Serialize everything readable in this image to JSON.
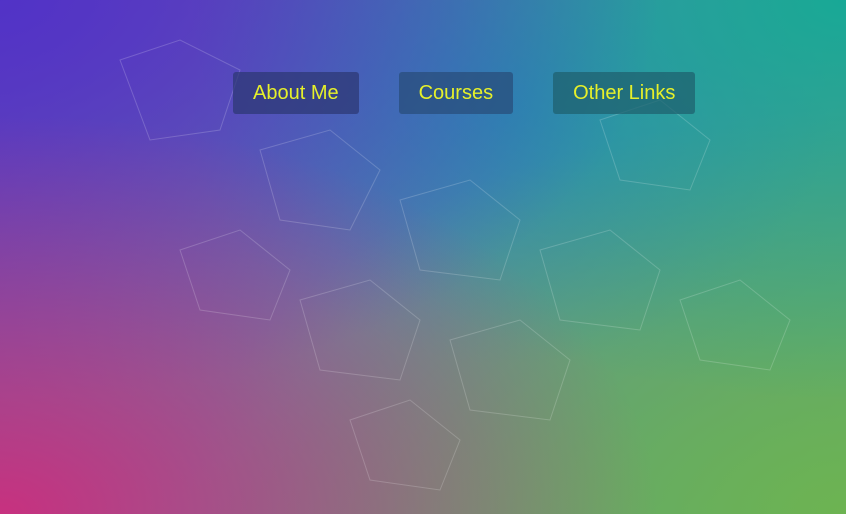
{
  "nav": {
    "items": [
      {
        "label": "About Me"
      },
      {
        "label": "Courses"
      },
      {
        "label": "Other Links"
      }
    ],
    "text_color": "#e6f02a"
  },
  "background": {
    "colors": [
      "#cd2d7d",
      "#5032c8",
      "#14aa96",
      "#6eb450"
    ]
  }
}
